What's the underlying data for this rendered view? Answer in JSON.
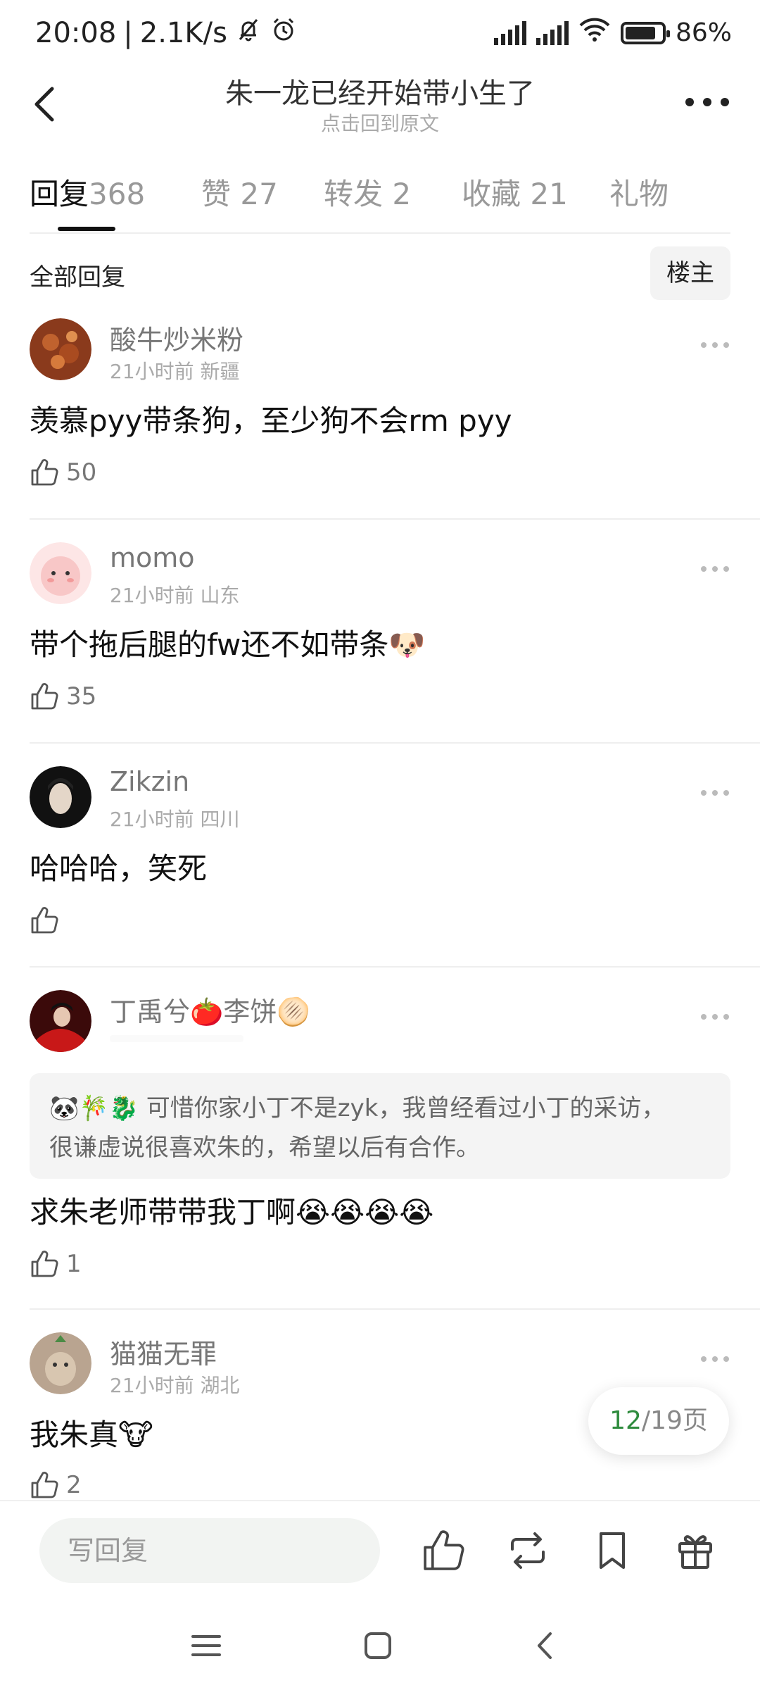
{
  "status_bar": {
    "time": "20:08",
    "separator": "|",
    "net_speed": "2.1K/s",
    "battery": "86%",
    "icons": [
      "bell-mute-icon",
      "alarm-icon",
      "hd-signal-icon",
      "hd-signal-icon",
      "wifi-icon",
      "battery-icon"
    ]
  },
  "nav": {
    "title": "朱一龙已经开始带小生了",
    "subtitle": "点击回到原文"
  },
  "tabs": [
    {
      "label": "回复",
      "count": "368",
      "active": true
    },
    {
      "label": "赞",
      "count": "27"
    },
    {
      "label": "转发",
      "count": "2"
    },
    {
      "label": "收藏",
      "count": "21"
    },
    {
      "label": "礼物",
      "count": ""
    }
  ],
  "filter": {
    "label": "全部回复",
    "owner_button": "楼主"
  },
  "comments": [
    {
      "username": "酸牛炒米粉",
      "time": "21小时前",
      "location": "新疆",
      "text": "羡慕pyy带条狗，至少狗不会rm pyy",
      "likes": "50"
    },
    {
      "username": "momo",
      "time": "21小时前",
      "location": "山东",
      "text": "带个拖后腿的fw还不如带条🐶",
      "likes": "35"
    },
    {
      "username": "Zikzin",
      "time": "21小时前",
      "location": "四川",
      "text": "哈哈哈，笑死",
      "likes": ""
    },
    {
      "username": "丁禹兮🍅李饼🫓",
      "time": "",
      "location": "",
      "quote_line1": "🐼🎋🐉 可惜你家小丁不是zyk，我曾经看过小丁的采访，",
      "quote_line2": "很谦虚说很喜欢朱的，希望以后有合作。",
      "text": "求朱老师带带我丁啊😭😭😭😭",
      "likes": "1"
    },
    {
      "username": "猫猫无罪",
      "time": "21小时前",
      "location": "湖北",
      "text": "我朱真🐮",
      "likes": "2"
    }
  ],
  "pagination": {
    "current": "12",
    "separator": "/",
    "total": "19页"
  },
  "bottom_bar": {
    "reply_placeholder": "写回复",
    "icons": [
      "like-icon",
      "repost-icon",
      "bookmark-icon",
      "gift-icon"
    ]
  },
  "system_nav": [
    "menu-icon",
    "home-icon",
    "back-icon"
  ]
}
